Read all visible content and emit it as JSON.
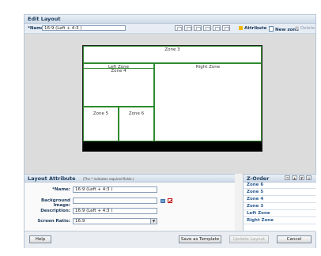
{
  "window": {
    "title": "Edit Layout"
  },
  "toolbar": {
    "name_label": "*Name:",
    "name_value": "16:9 (Left + 4:3 )",
    "attribute_label": "Attribute",
    "new_zone_label": "New zone",
    "delete_label": "Delete"
  },
  "canvas": {
    "zones": {
      "zone3": "Zone 3",
      "left_zone": "Left Zone",
      "zone4": "Zone 4",
      "right_zone": "Right Zone",
      "zone5": "Zone 5",
      "zone6": "Zone 6"
    }
  },
  "attribute_panel": {
    "title": "Layout Attribute",
    "note": "(The * indicates required fields.)",
    "name_label": "*Name:",
    "name_value": "16:9 (Left + 4:3 )",
    "bg_label": "Background Image:",
    "bg_value": "",
    "desc_label": "Description:",
    "desc_value": "16:9 (Left + 4:3 )",
    "ratio_label": "Screen Ratio:",
    "ratio_value": "16:9"
  },
  "zorder": {
    "title": "Z-Order",
    "items": [
      "Zone 6",
      "Zone 5",
      "Zone 4",
      "Zone 3",
      "Left Zone",
      "Right Zone"
    ]
  },
  "footer": {
    "help": "Help",
    "save_template": "Save as Template",
    "update_layout": "Update Layout",
    "cancel": "Cancel"
  }
}
